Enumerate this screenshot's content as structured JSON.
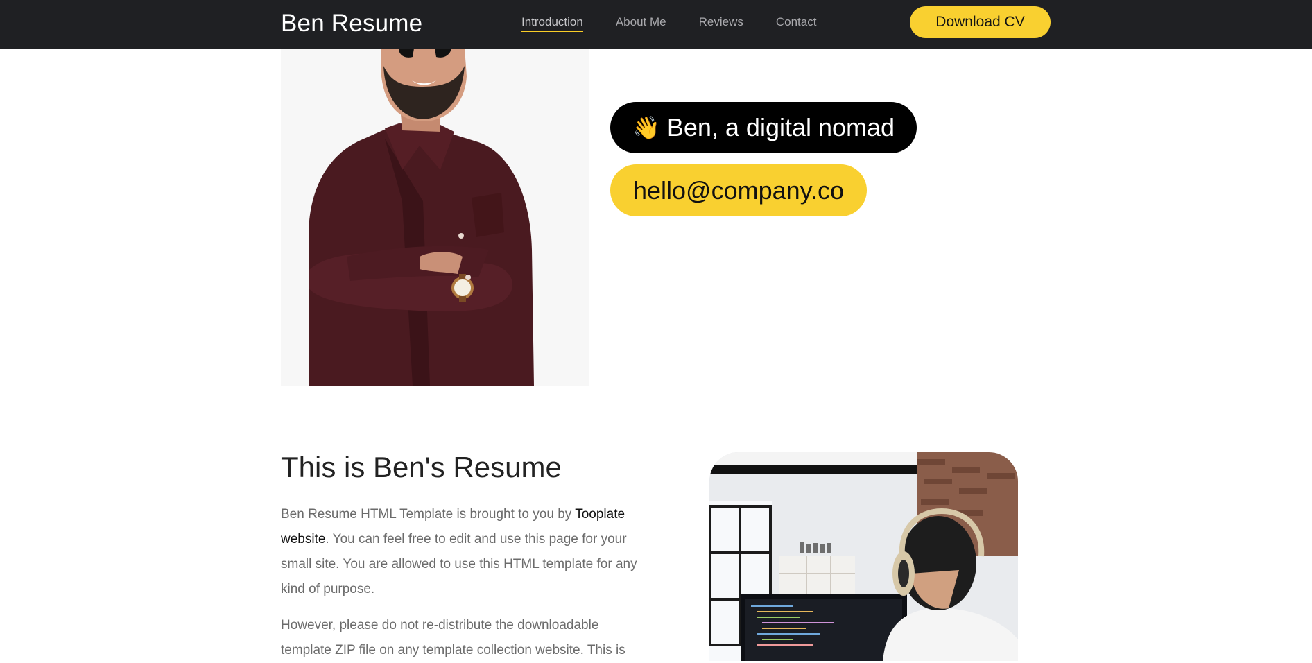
{
  "navbar": {
    "brand": "Ben Resume",
    "links": [
      {
        "label": "Introduction",
        "active": true
      },
      {
        "label": "About Me",
        "active": false
      },
      {
        "label": "Reviews",
        "active": false
      },
      {
        "label": "Contact",
        "active": false
      }
    ],
    "cta_label": "Download CV"
  },
  "hero": {
    "wave_icon": "👋",
    "greeting": "Ben, a digital nomad",
    "email": "hello@company.co"
  },
  "about": {
    "title": "This is Ben's Resume",
    "p1_before": "Ben Resume HTML Template is brought to you by ",
    "p1_link": "Tooplate website",
    "p1_after": ". You can feel free to edit and use this page for your small site. You are allowed to use this HTML template for any kind of purpose.",
    "p2": "However, please do not re-distribute the downloadable template ZIP file on any template collection website. This is"
  },
  "colors": {
    "nav_bg": "#1f2023",
    "accent": "#f9d030",
    "pill_dark": "#000000"
  }
}
